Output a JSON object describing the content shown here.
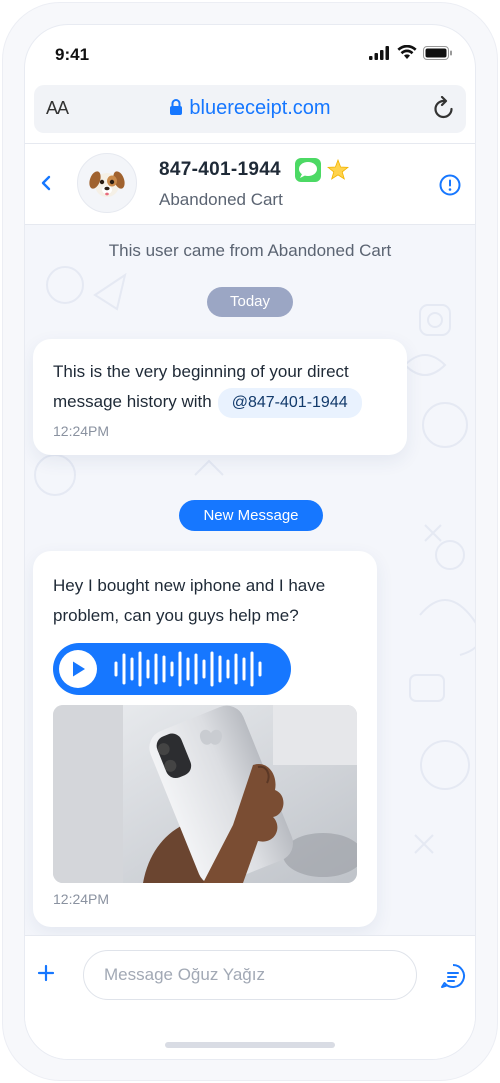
{
  "status_bar": {
    "time": "9:41"
  },
  "browser": {
    "text_size_label": "AA",
    "url": "bluereceipt.com"
  },
  "header": {
    "phone_number": "847-401-1944",
    "subtitle": "Abandoned Cart",
    "avatar_emoji": "🐶"
  },
  "chat": {
    "source_note": "This user came from Abandoned Cart",
    "date_divider": "Today",
    "first_message": {
      "text": "This is the very beginning of your direct message history with",
      "mention": "@847-401-1944",
      "timestamp": "12:24PM"
    },
    "new_message_divider": "New Message",
    "second_message": {
      "text": "Hey I bought new iphone and I have problem, can you guys help me?",
      "timestamp": "12:24PM"
    }
  },
  "composer": {
    "placeholder": "Message Oğuz Yağız"
  },
  "colors": {
    "accent": "#1677ff",
    "chat_background": "#f4f6fb",
    "date_pill": "#9ba6c4",
    "mention_bg": "#e9f2fe"
  },
  "icons": [
    "signal-icon",
    "wifi-icon",
    "battery-icon",
    "lock-icon",
    "reload-icon",
    "back-chevron-icon",
    "sms-icon",
    "star-icon",
    "info-icon",
    "play-icon",
    "plus-icon",
    "send-icon"
  ]
}
